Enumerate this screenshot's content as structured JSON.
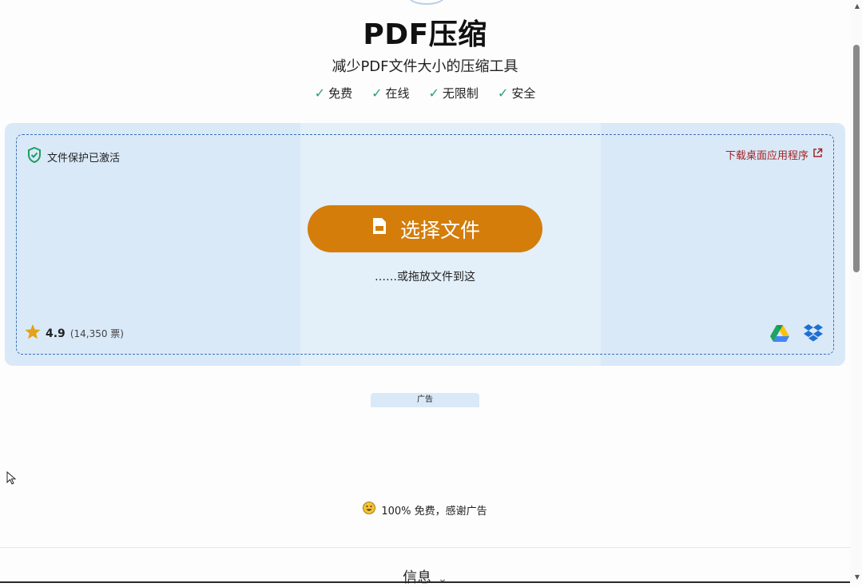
{
  "header": {
    "title": "PDF压缩",
    "subtitle": "减少PDF文件大小的压缩工具",
    "features": [
      {
        "check": "✓",
        "label": "免费"
      },
      {
        "check": "✓",
        "label": "在线"
      },
      {
        "check": "✓",
        "label": "无限制"
      },
      {
        "check": "✓",
        "label": "安全"
      }
    ]
  },
  "upload": {
    "protection_label": "文件保护已激活",
    "desktop_link": "下载桌面应用程序",
    "select_button": "选择文件",
    "drop_hint": "……或拖放文件到这",
    "rating_score": "4.9",
    "rating_votes": "(14,350 票)"
  },
  "ad_label": "广告",
  "thanks_text": "100% 免费，感谢广告",
  "info_section": {
    "label": "信息",
    "chevron": "⌄"
  },
  "colors": {
    "accent": "#d47d0a",
    "check": "#2b9f6c",
    "link": "#a12424",
    "upload_bg": "#d9e9f8",
    "dashed_border": "#3b6fb3"
  },
  "icons": [
    "shield-check-icon",
    "external-link-icon",
    "file-icon",
    "star-icon",
    "google-drive-icon",
    "dropbox-icon",
    "smiley-icon",
    "cursor-icon"
  ]
}
